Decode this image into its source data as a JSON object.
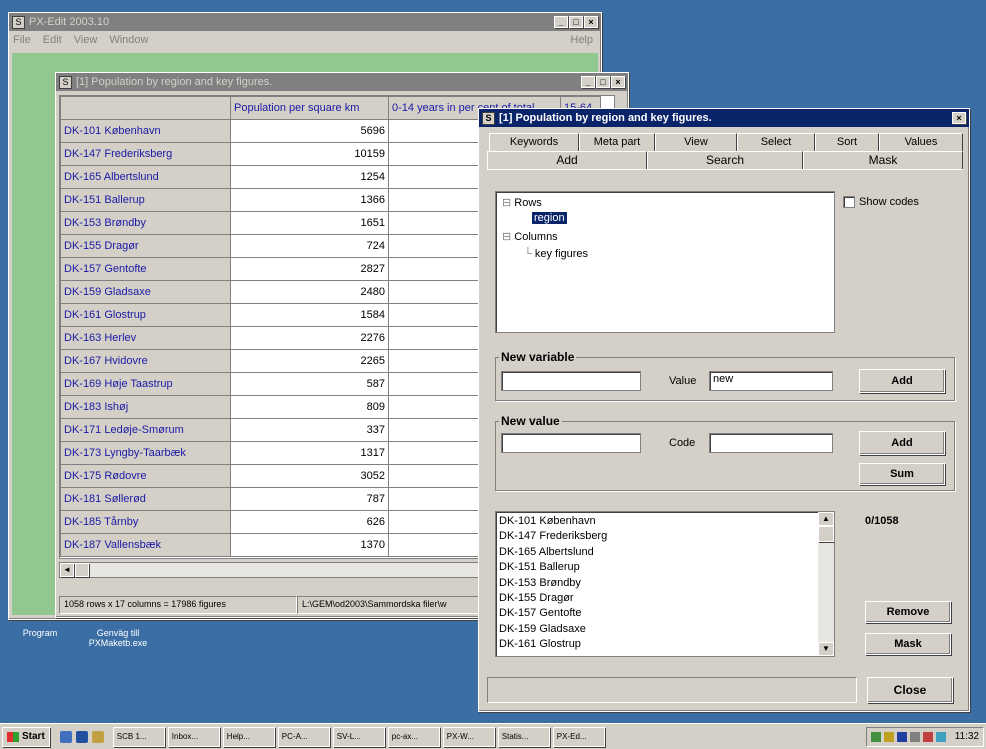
{
  "main_window": {
    "title": "PX-Edit 2003.10",
    "menu": [
      "File",
      "Edit",
      "View",
      "Window"
    ],
    "help": "Help"
  },
  "table_window": {
    "title": "[1] Population by region and key figures.",
    "columns": [
      "Population per square km",
      "0-14 years in per cent of total",
      "15-64"
    ],
    "rows": [
      {
        "region": "DK-101 København",
        "value": "5696"
      },
      {
        "region": "DK-147 Frederiksberg",
        "value": "10159"
      },
      {
        "region": "DK-165 Albertslund",
        "value": "1254"
      },
      {
        "region": "DK-151 Ballerup",
        "value": "1366"
      },
      {
        "region": "DK-153 Brøndby",
        "value": "1651"
      },
      {
        "region": "DK-155 Dragør",
        "value": "724"
      },
      {
        "region": "DK-157 Gentofte",
        "value": "2827"
      },
      {
        "region": "DK-159 Gladsaxe",
        "value": "2480"
      },
      {
        "region": "DK-161 Glostrup",
        "value": "1584"
      },
      {
        "region": "DK-163 Herlev",
        "value": "2276"
      },
      {
        "region": "DK-167 Hvidovre",
        "value": "2265"
      },
      {
        "region": "DK-169 Høje Taastrup",
        "value": "587"
      },
      {
        "region": "DK-183 Ishøj",
        "value": "809"
      },
      {
        "region": "DK-171 Ledøje-Smørum",
        "value": "337"
      },
      {
        "region": "DK-173 Lyngby-Taarbæk",
        "value": "1317"
      },
      {
        "region": "DK-175 Rødovre",
        "value": "3052"
      },
      {
        "region": "DK-181 Søllerød",
        "value": "787"
      },
      {
        "region": "DK-185 Tårnby",
        "value": "626"
      },
      {
        "region": "DK-187 Vallensbæk",
        "value": "1370"
      }
    ],
    "status_left": "1058 rows x 17 columns = 17986 figures",
    "status_right": "L:\\GEM\\od2003\\Sammordska filer\\w"
  },
  "dialog": {
    "title": "[1] Population by region and key figures.",
    "tabs_row1": [
      "Keywords",
      "Meta part",
      "View",
      "Select",
      "Sort",
      "Values"
    ],
    "tabs_row2": [
      "Add",
      "Search",
      "Mask"
    ],
    "tree": {
      "rows": "Rows",
      "region": "region",
      "columns": "Columns",
      "key_figures": "key figures"
    },
    "show_codes": "Show codes",
    "new_variable": {
      "label": "New variable",
      "name_value": "",
      "value_label": "Value",
      "value_value": "new",
      "add": "Add"
    },
    "new_value": {
      "label": "New value",
      "name_value": "",
      "code_label": "Code",
      "code_value": "",
      "add": "Add",
      "sum": "Sum"
    },
    "values_list": [
      "DK-101 København",
      "DK-147 Frederiksberg",
      "DK-165 Albertslund",
      "DK-151 Ballerup",
      "DK-153 Brøndby",
      "DK-155 Dragør",
      "DK-157 Gentofte",
      "DK-159 Gladsaxe",
      "DK-161 Glostrup"
    ],
    "count": "0/1058",
    "remove": "Remove",
    "mask": "Mask",
    "close": "Close"
  },
  "desktop": {
    "icon1": "Program",
    "icon2_line1": "Genväg till",
    "icon2_line2": "PXMaketb.exe"
  },
  "taskbar": {
    "start": "Start",
    "items": [
      "SCB 1...",
      "Inbox...",
      "Help...",
      "PC-A...",
      "SV-L...",
      "pc-ax...",
      "PX-W...",
      "Statis...",
      "PX-Ed..."
    ],
    "clock": "11:32"
  },
  "colors": {
    "desktop": "#3a6ea5",
    "active_title": "#0a246a",
    "inactive_title": "#808080",
    "link_text": "#1a1aa6",
    "mdi_bg": "#90c890"
  }
}
